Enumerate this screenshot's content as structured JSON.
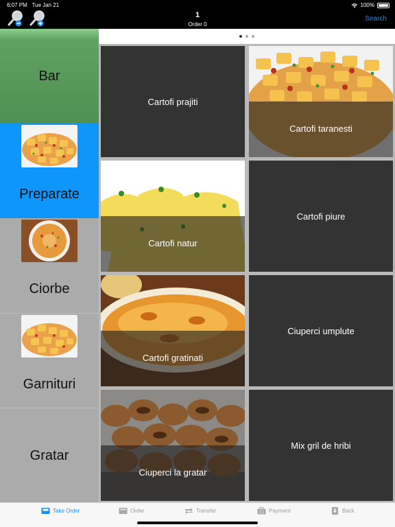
{
  "status": {
    "time": "6:07 PM",
    "date": "Tue Jan 21",
    "battery": "100%",
    "battery_level": 1.0
  },
  "header": {
    "order_number": "1",
    "order_label": "Order 0",
    "search_label": "Search"
  },
  "pager": {
    "pages": 3,
    "current": 1
  },
  "categories": [
    {
      "label": "Bar"
    },
    {
      "label": "Preparate",
      "selected": true
    },
    {
      "label": "Ciorbe"
    },
    {
      "label": "Garnituri"
    },
    {
      "label": "Gratar"
    }
  ],
  "products": [
    {
      "label": "Cartofi prajiti",
      "has_image": false
    },
    {
      "label": "Cartofi taranesti",
      "has_image": true
    },
    {
      "label": "Cartofi natur",
      "has_image": true
    },
    {
      "label": "Cartofi piure",
      "has_image": false
    },
    {
      "label": "Cartofi gratinati",
      "has_image": true
    },
    {
      "label": "Ciuperci umplute",
      "has_image": false
    },
    {
      "label": "Ciuperci la gratar",
      "has_image": true
    },
    {
      "label": "Mix gril de hribi",
      "has_image": false
    }
  ],
  "tabs": [
    {
      "label": "Take Order",
      "icon": "tray-icon",
      "active": true
    },
    {
      "label": "Order",
      "icon": "order-box-icon"
    },
    {
      "label": "Transfer",
      "icon": "transfer-arrows-icon"
    },
    {
      "label": "Payment",
      "icon": "briefcase-icon"
    },
    {
      "label": "Back",
      "icon": "back-arrow-icon"
    }
  ],
  "colors": {
    "accent": "#1e8cff",
    "bar_category": "#4f9152",
    "selected_category": "#0f96fb",
    "tile": "#333333"
  }
}
